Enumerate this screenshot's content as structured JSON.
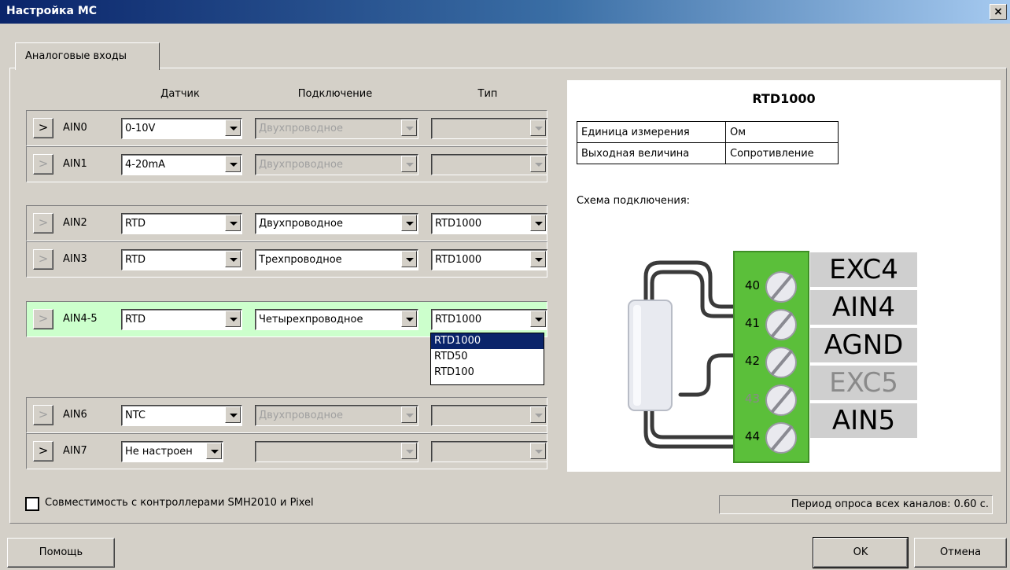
{
  "window": {
    "title": "Настройка МС",
    "close_glyph": "×"
  },
  "tab": {
    "label": "Аналоговые входы"
  },
  "headers": {
    "sensor": "Датчик",
    "connection": "Подключение",
    "type": "Тип"
  },
  "channels": [
    {
      "name": "AIN0",
      "arrow": ">",
      "sensor": "0-10V",
      "connection": "Двухпроводное",
      "type": ""
    },
    {
      "name": "AIN1",
      "arrow": ">",
      "sensor": "4-20mA",
      "connection": "Двухпроводное",
      "type": ""
    },
    {
      "name": "AIN2",
      "arrow": ">",
      "sensor": "RTD",
      "connection": "Двухпроводное",
      "type": "RTD1000"
    },
    {
      "name": "AIN3",
      "arrow": ">",
      "sensor": "RTD",
      "connection": "Трехпроводное",
      "type": "RTD1000"
    },
    {
      "name": "AIN4-5",
      "arrow": ">",
      "sensor": "RTD",
      "connection": "Четырехпроводное",
      "type": "RTD1000"
    },
    {
      "name": "AIN6",
      "arrow": ">",
      "sensor": "NTC",
      "connection": "Двухпроводное",
      "type": ""
    },
    {
      "name": "AIN7",
      "arrow": ">",
      "sensor": "Не настроен",
      "connection": "",
      "type": ""
    }
  ],
  "type_dropdown": {
    "options": [
      "RTD1000",
      "RTD50",
      "RTD100"
    ],
    "selected_index": 0
  },
  "info": {
    "title": "RTD1000",
    "table": [
      {
        "key": "Единица измерения",
        "value": "Ом"
      },
      {
        "key": "Выходная величина",
        "value": "Сопротивление"
      }
    ],
    "scheme_label": "Схема подключения:",
    "terminals": [
      {
        "pin": "40",
        "label": "EXC4",
        "active": true
      },
      {
        "pin": "41",
        "label": "AIN4",
        "active": true
      },
      {
        "pin": "42",
        "label": "AGND",
        "active": true
      },
      {
        "pin": "43",
        "label": "EXC5",
        "active": false
      },
      {
        "pin": "44",
        "label": "AIN5",
        "active": true
      }
    ]
  },
  "compat": {
    "label": "Совместимость с контроллерами SMH2010 и Pixel",
    "checked": false
  },
  "status": {
    "text": "Период опроса всех каналов: 0.60 с."
  },
  "buttons": {
    "help": "Помощь",
    "ok": "OK",
    "cancel": "Отмена"
  },
  "colors": {
    "selected_row": "#ccffcc",
    "terminal_green": "#5bbf3a",
    "highlight": "#0a246a"
  }
}
